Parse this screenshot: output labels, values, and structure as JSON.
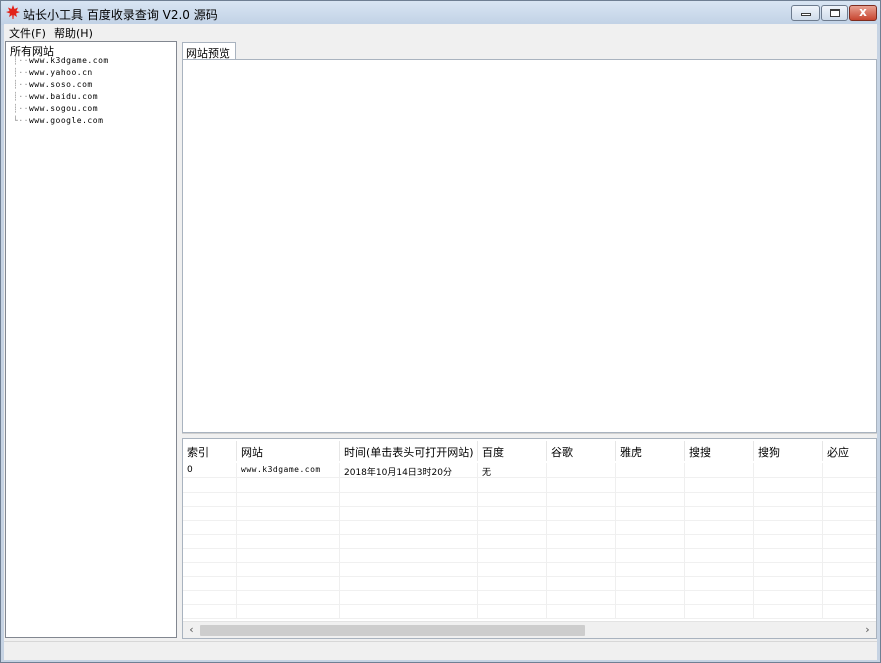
{
  "window": {
    "title": "站长小工具 百度收录查询 V2.0 源码",
    "app_icon": "red-maple-leaf-icon"
  },
  "caption_buttons": {
    "minimize": "minimize-icon",
    "maximize": "maximize-icon",
    "close": "close-icon",
    "close_glyph": "x"
  },
  "menu": {
    "items": [
      {
        "label": "文件(F)"
      },
      {
        "label": "帮助(H)"
      }
    ]
  },
  "tree": {
    "root": "所有网站",
    "nodes": [
      {
        "label": "www.k3dgame.com"
      },
      {
        "label": "www.yahoo.cn"
      },
      {
        "label": "www.soso.com"
      },
      {
        "label": "www.baidu.com"
      },
      {
        "label": "www.sogou.com"
      },
      {
        "label": "www.google.com"
      }
    ]
  },
  "tab": {
    "label": "网站预览"
  },
  "table": {
    "columns": [
      "索引",
      "网站",
      "时间(单击表头可打开网站)",
      "百度",
      "谷歌",
      "雅虎",
      "搜搜",
      "搜狗",
      "必应"
    ],
    "rows": [
      [
        "0",
        "www.k3dgame.com",
        "2018年10月14日3时20分",
        "无",
        "",
        "",
        "",
        "",
        ""
      ]
    ]
  },
  "scrollbar": {
    "left_arrow": "‹",
    "right_arrow": "›"
  },
  "colors": {
    "titlebar": "#c1d1e5",
    "close_button": "#c7452f"
  }
}
